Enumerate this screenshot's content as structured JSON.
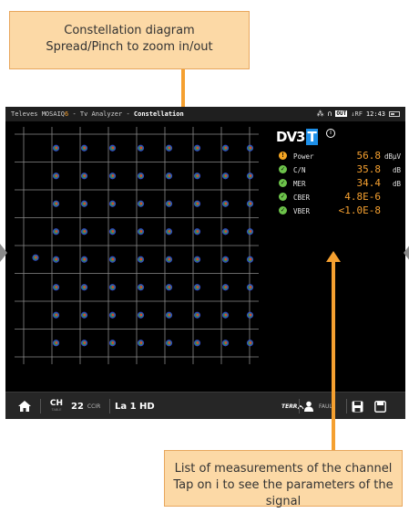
{
  "callouts": {
    "top_line1": "Constellation diagram",
    "top_line2": "Spread/Pinch to zoom in/out",
    "bottom_line1": "List of measurements of the channel",
    "bottom_line2": "Tap on i to see the parameters of the signal"
  },
  "statusbar": {
    "brand": "Televes MOSAIQ",
    "brand_suffix": "6",
    "app": " - Tv Analyzer - ",
    "screen": "Constellation",
    "out_badge": "OUT",
    "rf_label": "RF",
    "time": "12:43"
  },
  "signal": {
    "logo_text": "DV3",
    "logo_badge": "T",
    "info_icon": "i",
    "measurements": [
      {
        "label": "Power",
        "value": "56.8",
        "unit": "dBµV",
        "status": "warning",
        "color": "#f5a623",
        "icon": "!"
      },
      {
        "label": "C/N",
        "value": "35.8",
        "unit": "dB",
        "status": "ok",
        "color": "#6cc24a",
        "icon": "✓"
      },
      {
        "label": "MER",
        "value": "34.4",
        "unit": "dB",
        "status": "ok",
        "color": "#6cc24a",
        "icon": "✓"
      },
      {
        "label": "CBER",
        "value": "4.8E-6",
        "unit": "",
        "status": "ok",
        "color": "#6cc24a",
        "icon": "✓"
      },
      {
        "label": "VBER",
        "value": "<1.0E-8",
        "unit": "",
        "status": "ok",
        "color": "#6cc24a",
        "icon": "✓"
      }
    ]
  },
  "constellation": {
    "modulation_grid": "8x8 QAM",
    "grid_lines": 8,
    "point_color_inner": "#e03a3a",
    "point_color_outer": "#3a55e0"
  },
  "bottombar": {
    "home_icon": "home-icon",
    "ch_label": "CH",
    "ch_sub": "TABLE",
    "channel_number": "22",
    "channel_plan": "CCIR",
    "service_name": "La 1 HD",
    "terr_label": "TERR",
    "user_icon": "user-icon",
    "config_label": "FAULT",
    "save_icon": "save-icon",
    "screenshot_icon": "save-screen-icon"
  },
  "colors": {
    "accent": "#f5a030",
    "callout_bg": "#fcd9a6",
    "screen_bg": "#000000"
  }
}
